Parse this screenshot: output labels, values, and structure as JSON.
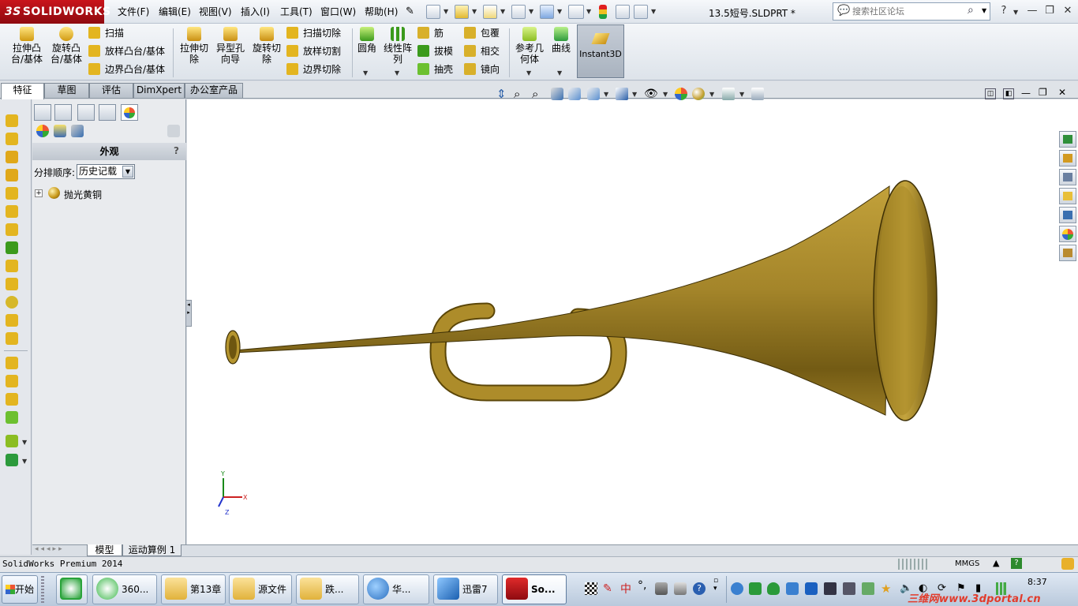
{
  "app": {
    "logo_text": "SOLIDWORKS",
    "logo_ds": "3S",
    "document_title": "13.5短号.SLDPRT *"
  },
  "menu": [
    "文件(F)",
    "编辑(E)",
    "视图(V)",
    "插入(I)",
    "工具(T)",
    "窗口(W)",
    "帮助(H)"
  ],
  "search": {
    "placeholder": "搜索社区论坛"
  },
  "window_controls": {
    "help": "?",
    "minimize": "—",
    "restore": "❐",
    "close": "✕"
  },
  "ribbon": {
    "extrude_boss": "拉伸凸\n台/基体",
    "revolve_boss": "旋转凸\n台/基体",
    "sweep": "扫描",
    "loft_boss": "放样凸台/基体",
    "boundary_boss": "边界凸台/基体",
    "extrude_cut": "拉伸切\n除",
    "hole_wizard": "异型孔\n向导",
    "revolve_cut": "旋转切\n除",
    "swept_cut": "扫描切除",
    "lofted_cut": "放样切割",
    "boundary_cut": "边界切除",
    "fillet": "圆角",
    "linear_pattern": "线性阵\n列",
    "rib": "筋",
    "draft": "拔模",
    "shell": "抽壳",
    "wrap": "包覆",
    "intersect": "相交",
    "mirror": "镜向",
    "ref_geometry": "参考几\n何体",
    "curves": "曲线",
    "instant3d": "Instant3D"
  },
  "tabs": [
    "特征",
    "草图",
    "评估",
    "DimXpert",
    "办公室产品"
  ],
  "panel": {
    "title": "外观",
    "help": "?",
    "sort_label": "分排顺序:",
    "sort_value": "历史记载",
    "tree_item": "抛光黄铜"
  },
  "bottom_tabs": [
    "模型",
    "运动算例 1"
  ],
  "status": {
    "left": "SolidWorks Premium 2014",
    "units": "MMGS",
    "help": "?"
  },
  "taskbar": {
    "start": "开始",
    "items": [
      "360...",
      "第13章",
      "源文件",
      "跌...",
      "华...",
      "迅雷7",
      "So..."
    ],
    "tray_text": "中",
    "clock": "8:37"
  },
  "watermark": "三维网www.3dportal.cn",
  "colors": {
    "brass": "#b08e2a",
    "brand_red": "#c9141b",
    "ribbon_bg": "#e6eaf0"
  }
}
